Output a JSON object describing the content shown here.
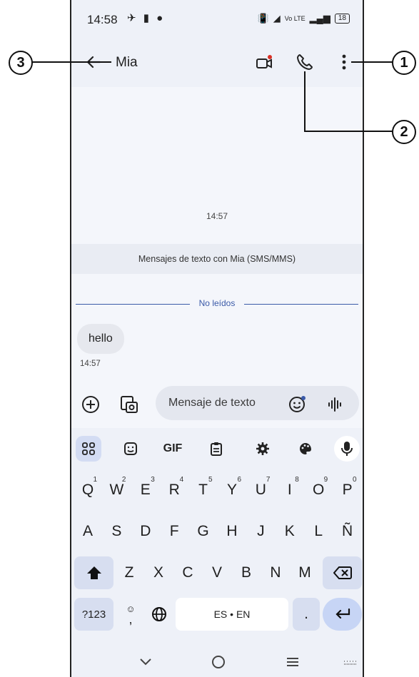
{
  "status": {
    "time": "14:58",
    "network": "Vo LTE",
    "battery": "18"
  },
  "appbar": {
    "title": "Mia"
  },
  "chat": {
    "timestamp_header": "14:57",
    "info": "Mensajes de texto con Mia (SMS/MMS)",
    "unread_label": "No leídos",
    "messages": [
      {
        "text": "hello",
        "time": "14:57"
      }
    ]
  },
  "compose": {
    "placeholder": "Mensaje de texto"
  },
  "keyboard": {
    "toolbar": {
      "gif": "GIF"
    },
    "row1": [
      {
        "k": "Q",
        "n": "1"
      },
      {
        "k": "W",
        "n": "2"
      },
      {
        "k": "E",
        "n": "3"
      },
      {
        "k": "R",
        "n": "4"
      },
      {
        "k": "T",
        "n": "5"
      },
      {
        "k": "Y",
        "n": "6"
      },
      {
        "k": "U",
        "n": "7"
      },
      {
        "k": "I",
        "n": "8"
      },
      {
        "k": "O",
        "n": "9"
      },
      {
        "k": "P",
        "n": "0"
      }
    ],
    "row2": [
      "A",
      "S",
      "D",
      "F",
      "G",
      "H",
      "J",
      "K",
      "L",
      "Ñ"
    ],
    "row3": [
      "Z",
      "X",
      "C",
      "V",
      "B",
      "N",
      "M"
    ],
    "symbols_label": "?123",
    "comma": ",",
    "space_label": "ES • EN",
    "period": "."
  },
  "callouts": {
    "c1": "1",
    "c2": "2",
    "c3": "3"
  },
  "colors": {
    "accent": "#3b5aa8",
    "notification_dot": "#d93025",
    "bg": "#f4f6fb"
  }
}
